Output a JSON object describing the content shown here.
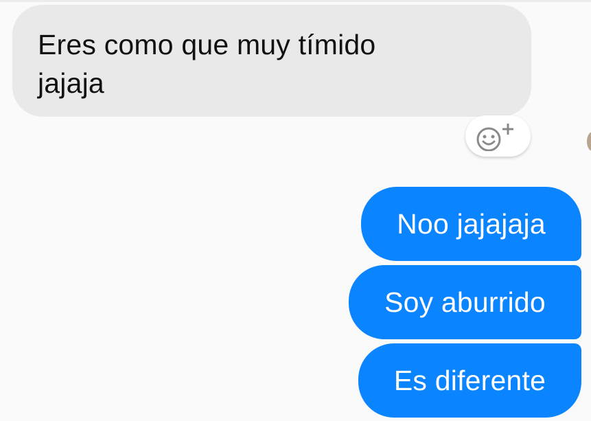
{
  "conversation": {
    "received_message": "Eres como que muy tímido\njajaja",
    "sent_messages": [
      "Noo jajajaja",
      "Soy aburrido",
      "Es diferente"
    ]
  },
  "reaction": {
    "icon": "smiley-plus-icon"
  },
  "colors": {
    "sent_bubble": "#0b84ff",
    "received_bubble": "#e9e9e9",
    "background": "#fafafa"
  }
}
